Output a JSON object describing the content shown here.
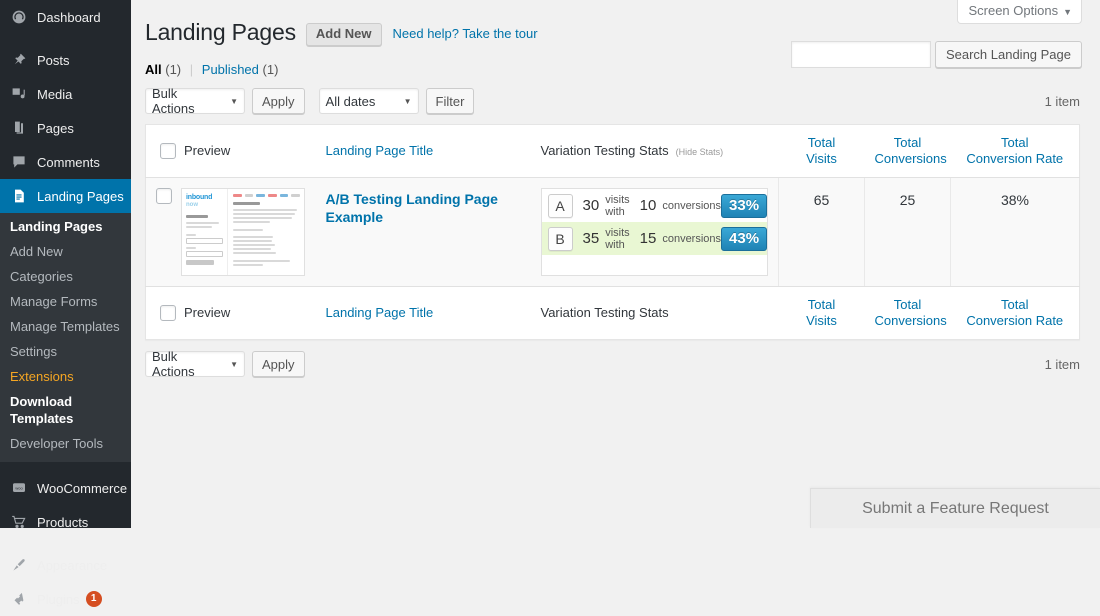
{
  "sidebar": {
    "top_items": [
      {
        "label": "Dashboard",
        "icon": "dashboard-icon",
        "current": false
      },
      {
        "label": "Posts",
        "icon": "pin-icon",
        "current": false
      },
      {
        "label": "Media",
        "icon": "media-icon",
        "current": false
      },
      {
        "label": "Pages",
        "icon": "pages-icon",
        "current": false
      },
      {
        "label": "Comments",
        "icon": "comments-icon",
        "current": false
      },
      {
        "label": "Landing Pages",
        "icon": "document-icon",
        "current": true
      }
    ],
    "submenu": [
      {
        "label": "Landing Pages",
        "state": "current"
      },
      {
        "label": "Add New",
        "state": "normal"
      },
      {
        "label": "Categories",
        "state": "normal"
      },
      {
        "label": "Manage Forms",
        "state": "normal"
      },
      {
        "label": "Manage Templates",
        "state": "normal"
      },
      {
        "label": "Settings",
        "state": "normal"
      },
      {
        "label": "Extensions",
        "state": "accent"
      },
      {
        "label": "Download Templates",
        "state": "bold"
      },
      {
        "label": "Developer Tools",
        "state": "normal"
      }
    ],
    "bottom_items": [
      {
        "label": "WooCommerce",
        "icon": "woo-icon"
      },
      {
        "label": "Products",
        "icon": "cart-icon"
      },
      {
        "label": "Appearance",
        "icon": "brush-icon"
      },
      {
        "label": "Plugins",
        "icon": "plug-icon",
        "badge": "1"
      }
    ],
    "accent_color": "#0073aa",
    "badge_color": "#d54e21"
  },
  "screen_options": {
    "label": "Screen Options",
    "caret": "▼"
  },
  "header": {
    "title": "Landing Pages",
    "add_new": "Add New",
    "tour_link": "Need help? Take the tour"
  },
  "subsub": {
    "all_label": "All",
    "all_count": "(1)",
    "separator": "|",
    "published_label": "Published",
    "published_count": "(1)"
  },
  "search": {
    "value": "",
    "placeholder": "",
    "button": "Search Landing Page"
  },
  "tablenav_top": {
    "bulk_actions": "Bulk Actions",
    "apply": "Apply",
    "dates": "All dates",
    "filter": "Filter",
    "displaying": "1 item"
  },
  "tablenav_bottom": {
    "bulk_actions": "Bulk Actions",
    "apply": "Apply",
    "displaying": "1 item"
  },
  "table": {
    "columns": {
      "preview": "Preview",
      "title": "Landing Page Title",
      "stats": "Variation Testing Stats",
      "hide_stats": "(Hide Stats)",
      "visits_line1": "Total",
      "visits_line2": "Visits",
      "conversions_line1": "Total",
      "conversions_line2": "Conversions",
      "rate_line1": "Total",
      "rate_line2": "Conversion Rate"
    },
    "row": {
      "title": "A/B Testing Landing Page Example",
      "thumbnail_logo_line1": "inbound",
      "thumbnail_logo_line2": "now",
      "total_visits": "65",
      "total_conversions": "25",
      "total_conversion_rate": "38%",
      "variations": [
        {
          "letter": "A",
          "visits": "30",
          "mid_text": "visits with",
          "conversions": "10",
          "end_text": "conversions",
          "rate": "33%",
          "winner": false
        },
        {
          "letter": "B",
          "visits": "35",
          "mid_text": "visits with",
          "conversions": "15",
          "end_text": "conversions",
          "rate": "43%",
          "winner": true
        }
      ]
    }
  },
  "footer": {
    "feature_request": "Submit a Feature Request"
  },
  "colors": {
    "badge_blue": "#2a93c7",
    "winner_green": "#e9f7d3",
    "link_blue": "#0073aa"
  }
}
